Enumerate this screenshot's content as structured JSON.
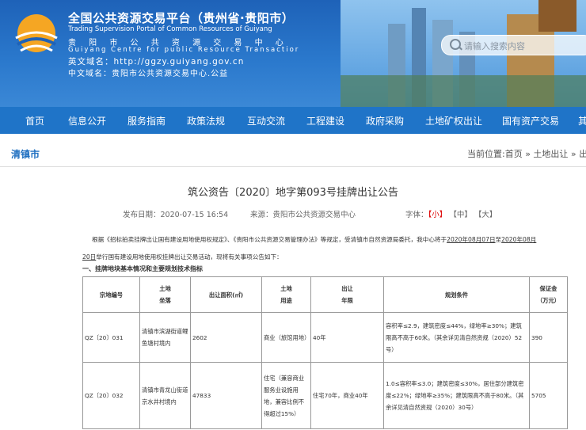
{
  "header": {
    "title_cn": "全国公共资源交易平台（贵州省·贵阳市）",
    "title_en": "Trading Supervision Portal of Common Resources of Guiyang",
    "org_cn": "贵 阳 市 公 共 资 源 交 易 中 心",
    "org_en": "Guiyang Centre for public Resource Transactior",
    "domain_en": "英文域名：http://ggzy.guiyang.gov.cn",
    "domain_cn": "中文域名：贵阳市公共资源交易中心.公益",
    "search_placeholder": "请输入搜索内容"
  },
  "nav": [
    "首页",
    "信息公开",
    "服务指南",
    "政策法规",
    "互动交流",
    "工程建设",
    "政府采购",
    "土地矿权出让",
    "国有资产交易",
    "其"
  ],
  "breadcrumb": {
    "section": "清镇市",
    "path": "当前位置:首页 » 土地出让 » 出让"
  },
  "article": {
    "title": "筑公资告〔2020〕地字第093号挂牌出让公告",
    "date": "发布日期：2020-07-15 16:54",
    "source": "来源：贵阳市公共资源交易中心",
    "font_label": "字体：",
    "font_small": "【小】",
    "font_mid": "【中】",
    "font_large": "【大】",
    "para_a": "根据《招标拍卖挂牌出让国有建设用地使用权规定》、《贵阳市公共资源交易管理办法》等规定，受清镇市自然资源局委托，我中心将于",
    "para_date1": "2020年08月07日",
    "para_b": "至",
    "para_date2": "2020年08月",
    "para_date3": "20日",
    "para_c": "举行国有建设用地使用权挂牌出让交易活动，现将有关事项公告如下：",
    "section1": "一、挂牌地块基本情况和主要规划技术指标"
  },
  "table": {
    "headers": [
      "宗地编号",
      "土地\n坐落",
      "出让面积(㎡)",
      "土地\n用途",
      "出让\n年限",
      "规划条件",
      "保证金\n（万元）"
    ],
    "rows": [
      [
        "QZ〔20〕031",
        "清镇市滨湖街道鲤鱼塘村境内",
        "2602",
        "商业（旅馆用地）",
        "40年",
        "容积率≤2.9，建筑密度≤44%，绿地率≥30%；建筑限高不高于60米。（其余详见清自然资规（2020）52号）",
        "390"
      ],
      [
        "QZ〔20〕032",
        "清镇市青龙山街道京水井村境内",
        "47833",
        "住宅（兼容商业服务业设施用地，兼容比例不得超过15%）",
        "住宅70年，商业40年",
        "1.0≤容积率≤3.0；建筑密度≤30%，居住部分建筑密度≤22%；绿地率≥35%；建筑限高不高于80米。（其余详见清自然资规（2020）30号）",
        "5705"
      ]
    ]
  }
}
